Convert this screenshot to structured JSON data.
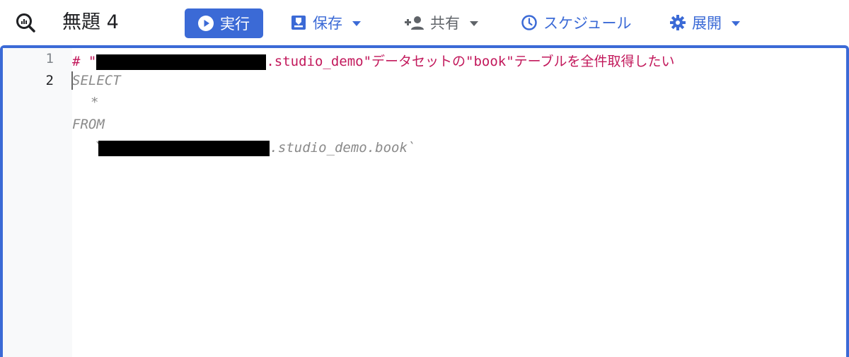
{
  "toolbar": {
    "title": "無題 4",
    "run_label": "実行",
    "save_label": "保存",
    "share_label": "共有",
    "schedule_label": "スケジュール",
    "deploy_label": "展開"
  },
  "colors": {
    "accent": "#3b6ad6",
    "comment": "#c2185b",
    "keyword": "#8a8a8a"
  },
  "editor": {
    "line_numbers": [
      "1",
      "2"
    ],
    "lines": {
      "comment_prefix": "# \"",
      "comment_suffix": ".studio_demo\"データセットの\"book\"テーブルを全件取得したい",
      "select": "SELECT",
      "star": "*",
      "from": "FROM",
      "table_prefix": "`",
      "table_suffix": ".studio_demo.book`"
    }
  }
}
